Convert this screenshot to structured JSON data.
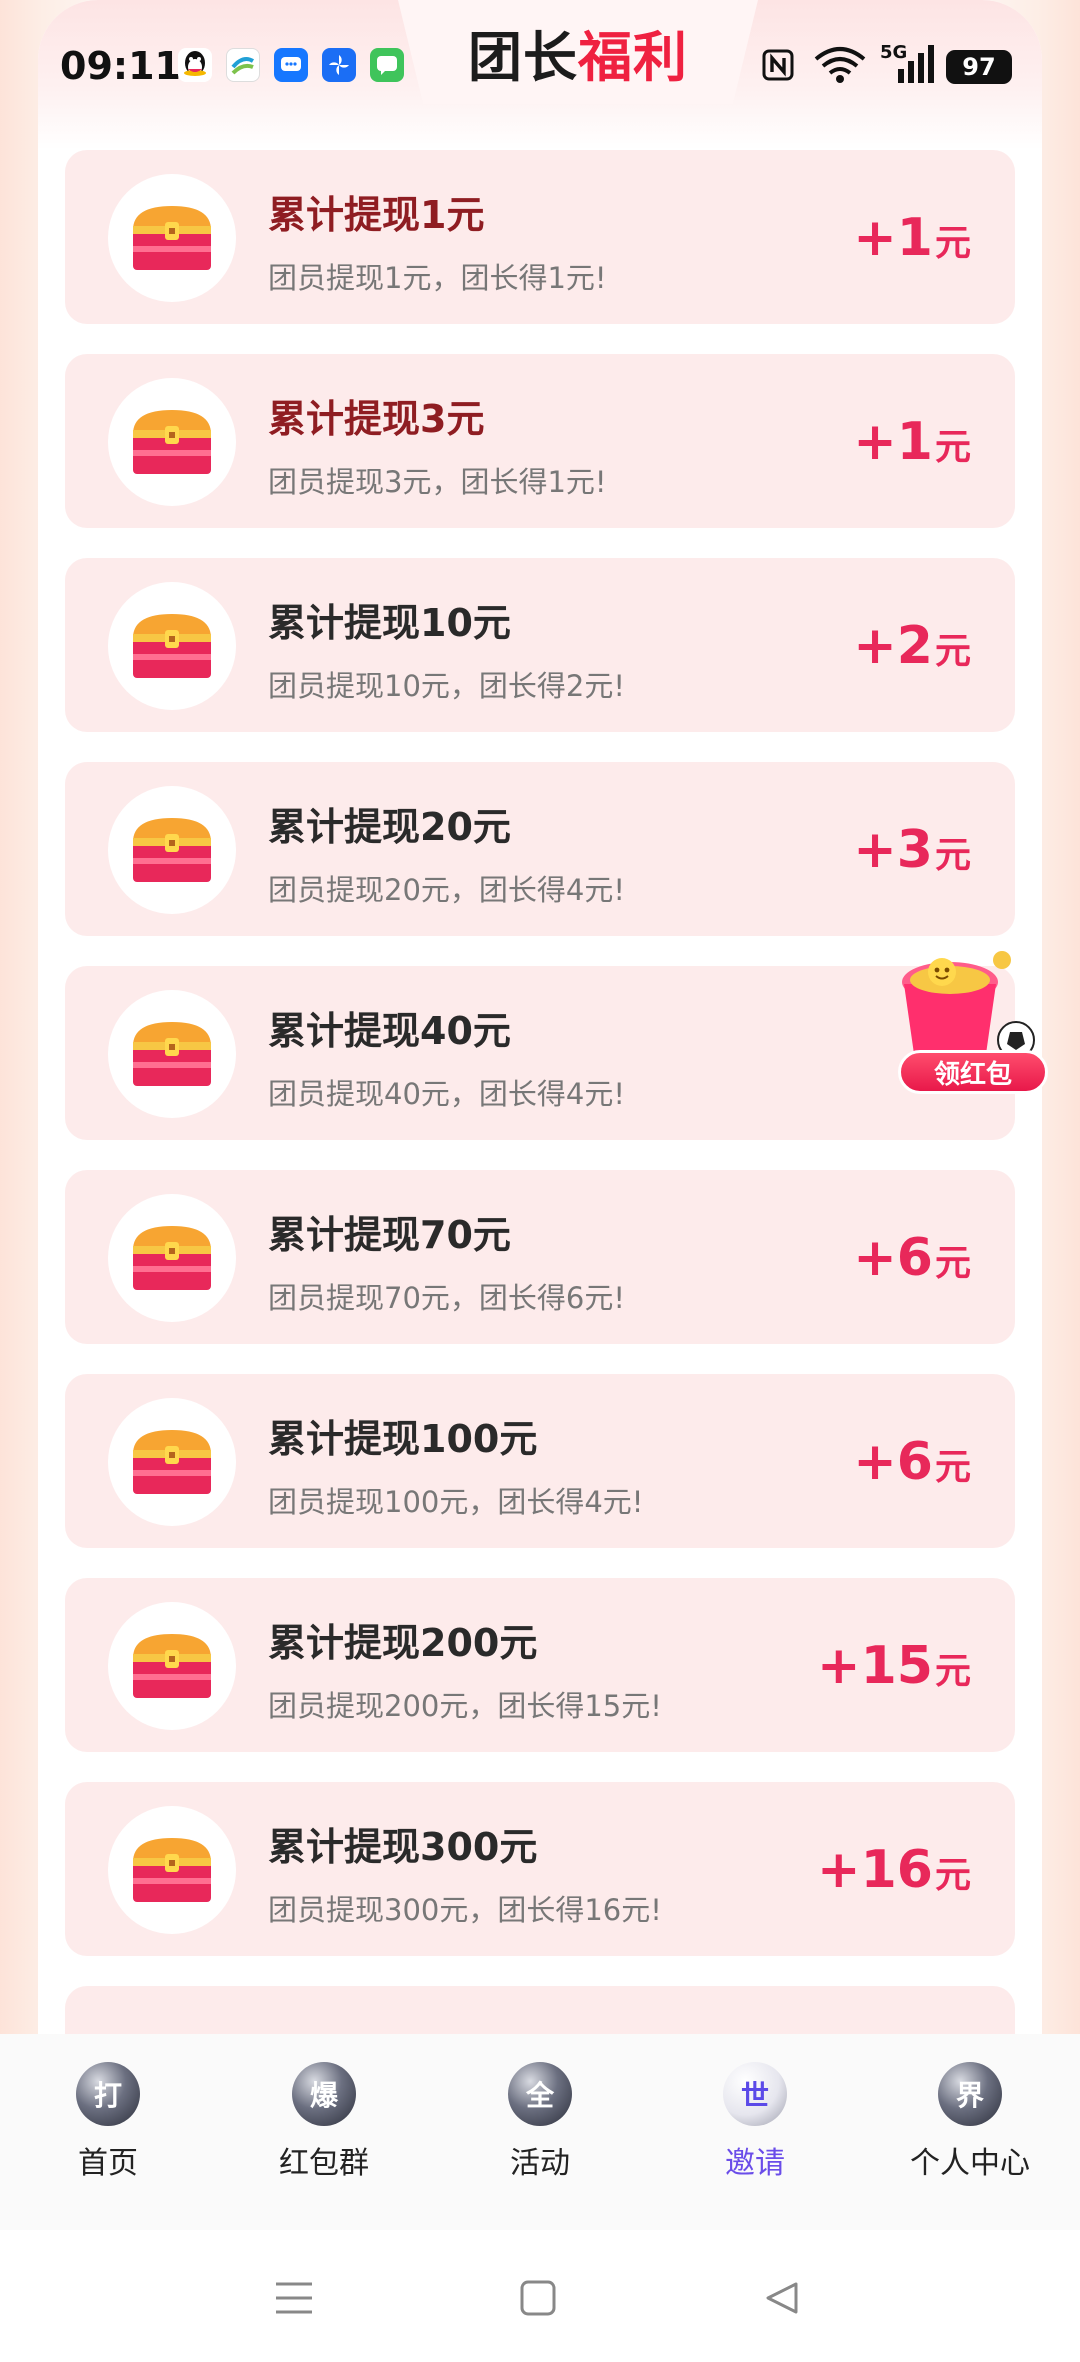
{
  "status_bar": {
    "time": "09:11",
    "left_icons": [
      "qq-icon",
      "china-mobile-icon",
      "message-icon",
      "pinwheel-icon",
      "chat-icon"
    ],
    "right_icons": [
      "nfc-icon",
      "wifi-icon",
      "signal-5g-icon"
    ],
    "network_label": "5G",
    "battery": "97"
  },
  "header": {
    "title_main": "团长",
    "title_accent": "福利"
  },
  "colors": {
    "accent": "#e8285a",
    "title_accent": "#ef2140",
    "completed_title": "#8f1d22",
    "card_bg": "#fdebeb",
    "nav_active": "#6a4de9"
  },
  "tasks": [
    {
      "title": "累计提现1元",
      "desc": "团员提现1元，团长得1元!",
      "reward": "+1",
      "unit": "元",
      "completed": true
    },
    {
      "title": "累计提现3元",
      "desc": "团员提现3元，团长得1元!",
      "reward": "+1",
      "unit": "元",
      "completed": true
    },
    {
      "title": "累计提现10元",
      "desc": "团员提现10元，团长得2元!",
      "reward": "+2",
      "unit": "元",
      "completed": false
    },
    {
      "title": "累计提现20元",
      "desc": "团员提现20元，团长得4元!",
      "reward": "+3",
      "unit": "元",
      "completed": false
    },
    {
      "title": "累计提现40元",
      "desc": "团员提现40元，团长得4元!",
      "reward": "+",
      "unit": "",
      "completed": false
    },
    {
      "title": "累计提现70元",
      "desc": "团员提现70元，团长得6元!",
      "reward": "+6",
      "unit": "元",
      "completed": false
    },
    {
      "title": "累计提现100元",
      "desc": "团员提现100元，团长得4元!",
      "reward": "+6",
      "unit": "元",
      "completed": false
    },
    {
      "title": "累计提现200元",
      "desc": "团员提现200元，团长得15元!",
      "reward": "+15",
      "unit": "元",
      "completed": false
    },
    {
      "title": "累计提现300元",
      "desc": "团员提现300元，团长得16元!",
      "reward": "+16",
      "unit": "元",
      "completed": false
    }
  ],
  "float_badge": {
    "label": "领红包"
  },
  "bottom_nav": [
    {
      "glyph": "打",
      "label": "首页",
      "active": false
    },
    {
      "glyph": "爆",
      "label": "红包群",
      "active": false
    },
    {
      "glyph": "全",
      "label": "活动",
      "active": false
    },
    {
      "glyph": "世",
      "label": "邀请",
      "active": true
    },
    {
      "glyph": "界",
      "label": "个人中心",
      "active": false
    }
  ],
  "system_nav": [
    "menu-icon",
    "home-icon",
    "back-icon"
  ]
}
